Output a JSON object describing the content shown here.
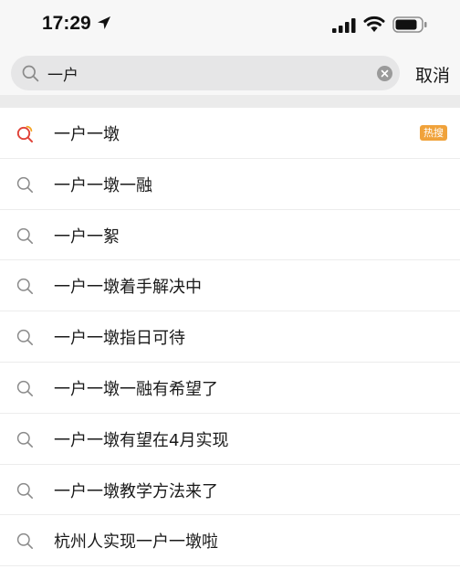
{
  "status_bar": {
    "time": "17:29",
    "icons": [
      "location-arrow-icon",
      "cellular-signal-icon",
      "wifi-icon",
      "battery-icon"
    ]
  },
  "search": {
    "query": "一户",
    "icon": "search-icon",
    "clear_icon": "clear-icon",
    "cancel_label": "取消"
  },
  "colors": {
    "hot_badge": "#f0a23a",
    "hot_icon_red": "#e0443a",
    "hot_icon_orange": "#f5a623",
    "search_box": "#e6e6e7"
  },
  "suggestions": [
    {
      "text": "一户一墩",
      "badge": "热搜",
      "icon": "hot-search-icon"
    },
    {
      "text": "一户一墩一融",
      "icon": "search-icon"
    },
    {
      "text": "一户一絮",
      "icon": "search-icon"
    },
    {
      "text": "一户一墩着手解决中",
      "icon": "search-icon"
    },
    {
      "text": "一户一墩指日可待",
      "icon": "search-icon"
    },
    {
      "text": "一户一墩一融有希望了",
      "icon": "search-icon"
    },
    {
      "text": "一户一墩有望在4月实现",
      "icon": "search-icon"
    },
    {
      "text": "一户一墩教学方法来了",
      "icon": "search-icon"
    },
    {
      "text": "杭州人实现一户一墩啦",
      "icon": "search-icon"
    }
  ]
}
